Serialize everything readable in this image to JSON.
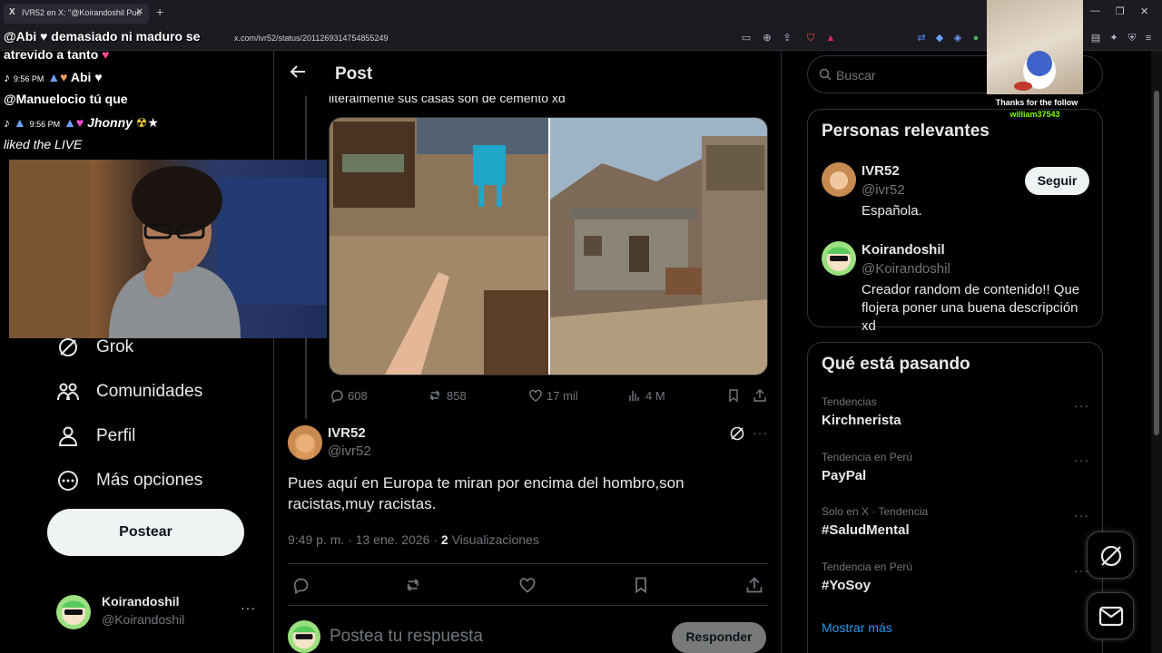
{
  "browser": {
    "tab_title": "IVR52 en X: \"@Koirandoshil Pue",
    "url": "x.com/ivr52/status/2011269314754855249"
  },
  "chat": {
    "lines": [
      {
        "user": "@Abi",
        "text": "demasiado ni maduro se"
      },
      {
        "text": "atrevido a tanto"
      },
      {
        "time": "9:56 PM",
        "user": "Abi"
      },
      {
        "user": "@Manuelocio",
        "text": "tú que"
      },
      {
        "time": "9:56 PM",
        "user": "Jhonny"
      },
      {
        "text": "liked the LIVE"
      }
    ]
  },
  "nav": {
    "items": [
      {
        "label": "Grok",
        "icon": "grok-icon"
      },
      {
        "label": "Comunidades",
        "icon": "communities-icon"
      },
      {
        "label": "Perfil",
        "icon": "profile-icon"
      },
      {
        "label": "Más opciones",
        "icon": "more-options-icon"
      }
    ],
    "post_button": "Postear",
    "account": {
      "name": "Koirandoshil",
      "handle": "@Koirandoshil",
      "more": "···"
    }
  },
  "main": {
    "header_title": "Post",
    "prev_post_text": "literalmente sus casas son de cemento xd",
    "prev_post_stats": {
      "replies": "608",
      "reposts": "858",
      "likes": "17 mil",
      "views": "4 M"
    },
    "reply": {
      "author_name": "IVR52",
      "author_handle": "@ivr52",
      "text": "Pues aquí en Europa te miran por encima del hombro,son racistas,muy racistas.",
      "time": "9:49 p. m. · 13 ene. 2026 ·",
      "views_count": "2",
      "views_label": "Visualizaciones"
    },
    "compose": {
      "placeholder": "Postea tu respuesta",
      "button": "Responder"
    }
  },
  "sidebar": {
    "search_placeholder": "Buscar",
    "relevant_title": "Personas relevantes",
    "people": [
      {
        "name": "IVR52",
        "handle": "@ivr52",
        "bio": "Española.",
        "follow": "Seguir"
      },
      {
        "name": "Koirandoshil",
        "handle": "@Koirandoshil",
        "bio": "Creador random de contenido!! Que flojera poner una buena descripción xd"
      }
    ],
    "trends_title": "Qué está pasando",
    "trends": [
      {
        "context": "Tendencias",
        "name": "Kirchnerista"
      },
      {
        "context": "Tendencia en Perú",
        "name": "PayPal"
      },
      {
        "context": "Solo en X · Tendencia",
        "name": "#SaludMental"
      },
      {
        "context": "Tendencia en Perú",
        "name": "#YoSoy"
      }
    ],
    "show_more": "Mostrar más"
  },
  "follow_alert": {
    "text": "Thanks for the follow",
    "user": "william37543"
  },
  "colors": {
    "accent": "#1d9bf0",
    "background": "#000000",
    "text": "#e7e9ea",
    "muted": "#71767b"
  }
}
